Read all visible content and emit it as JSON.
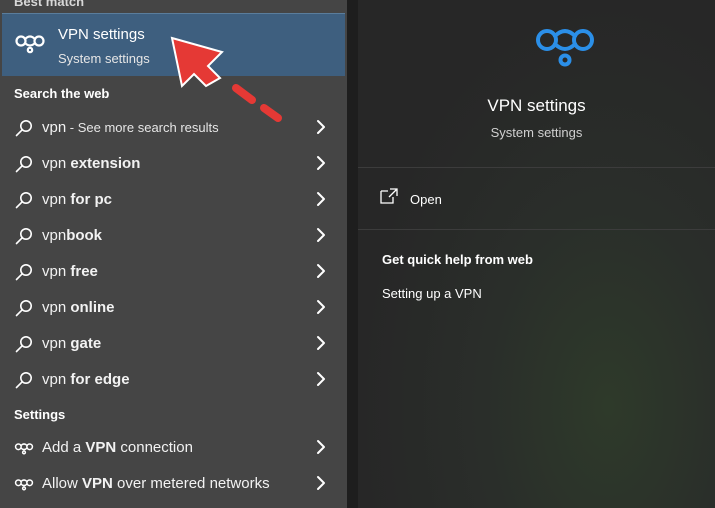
{
  "sections": {
    "best_match": "Best match",
    "search_web": "Search the web",
    "settings": "Settings"
  },
  "best_match": {
    "title": "VPN settings",
    "subtitle": "System settings",
    "icon": "vpn-icon"
  },
  "web_results": [
    {
      "prefix": "vpn",
      "bold": "",
      "suffix": " - See more search results"
    },
    {
      "prefix": "vpn ",
      "bold": "extension",
      "suffix": ""
    },
    {
      "prefix": "vpn ",
      "bold": "for pc",
      "suffix": ""
    },
    {
      "prefix": "vpn",
      "bold": "book",
      "suffix": ""
    },
    {
      "prefix": "vpn ",
      "bold": "free",
      "suffix": ""
    },
    {
      "prefix": "vpn ",
      "bold": "online",
      "suffix": ""
    },
    {
      "prefix": "vpn ",
      "bold": "gate",
      "suffix": ""
    },
    {
      "prefix": "vpn ",
      "bold": "for edge",
      "suffix": ""
    }
  ],
  "settings_results": [
    {
      "prefix": "Add a ",
      "bold": "VPN",
      "suffix": " connection"
    },
    {
      "prefix": "Allow ",
      "bold": "VPN",
      "suffix": " over metered networks"
    }
  ],
  "preview": {
    "title": "VPN settings",
    "subtitle": "System settings",
    "open_label": "Open",
    "help_heading": "Get quick help from web",
    "help_link": "Setting up a VPN"
  },
  "colors": {
    "accent": "#3e5f7f",
    "vpn_icon_blue": "#2b8fe8",
    "annotation_arrow": "#e53935"
  }
}
